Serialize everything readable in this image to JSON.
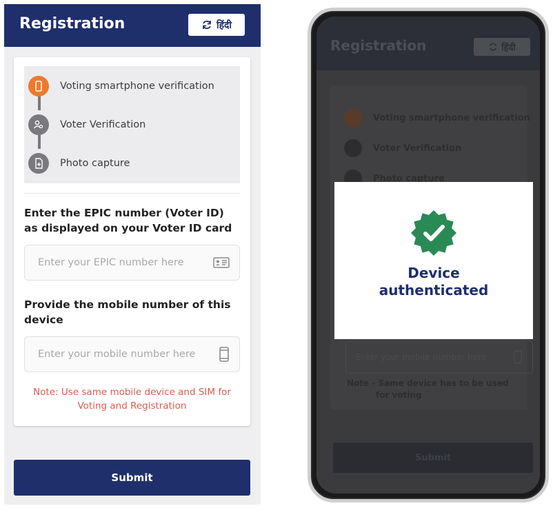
{
  "left_screen": {
    "header": {
      "title": "Registration",
      "language_toggle": "हिंदी"
    },
    "steps": [
      {
        "label": "Voting smartphone verification",
        "state": "active"
      },
      {
        "label": "Voter Verification",
        "state": "pending"
      },
      {
        "label": "Photo capture",
        "state": "pending"
      }
    ],
    "epic": {
      "label": "Enter the EPIC number (Voter ID) as displayed on your Voter ID card",
      "placeholder": "Enter your EPIC number here",
      "icon": "id-card-icon"
    },
    "mobile": {
      "label": "Provide the mobile number of this device",
      "placeholder": "Enter your mobile number here",
      "icon": "mobile-phone-icon"
    },
    "note": "Note: Use same mobile device and SIM for Voting and Registration",
    "submit_label": "Submit"
  },
  "right_screen": {
    "header": {
      "title": "Registration",
      "language_toggle": "हिंदी"
    },
    "steps": [
      {
        "label": "Voting smartphone verification"
      },
      {
        "label": "Voter Verification"
      },
      {
        "label": "Photo capture"
      }
    ],
    "mobile_placeholder": "Enter your mobile number here",
    "note_line1": "Note - Same device has to be used",
    "note_line2": "for voting",
    "submit_label": "Submit",
    "modal": {
      "line1": "Device",
      "line2": "authenticated",
      "icon": "verified-badge-icon"
    }
  },
  "colors": {
    "primary": "#1e2f6b",
    "active_step": "#ed7a2c",
    "note": "#dc5b52",
    "success": "#2a8a55"
  }
}
